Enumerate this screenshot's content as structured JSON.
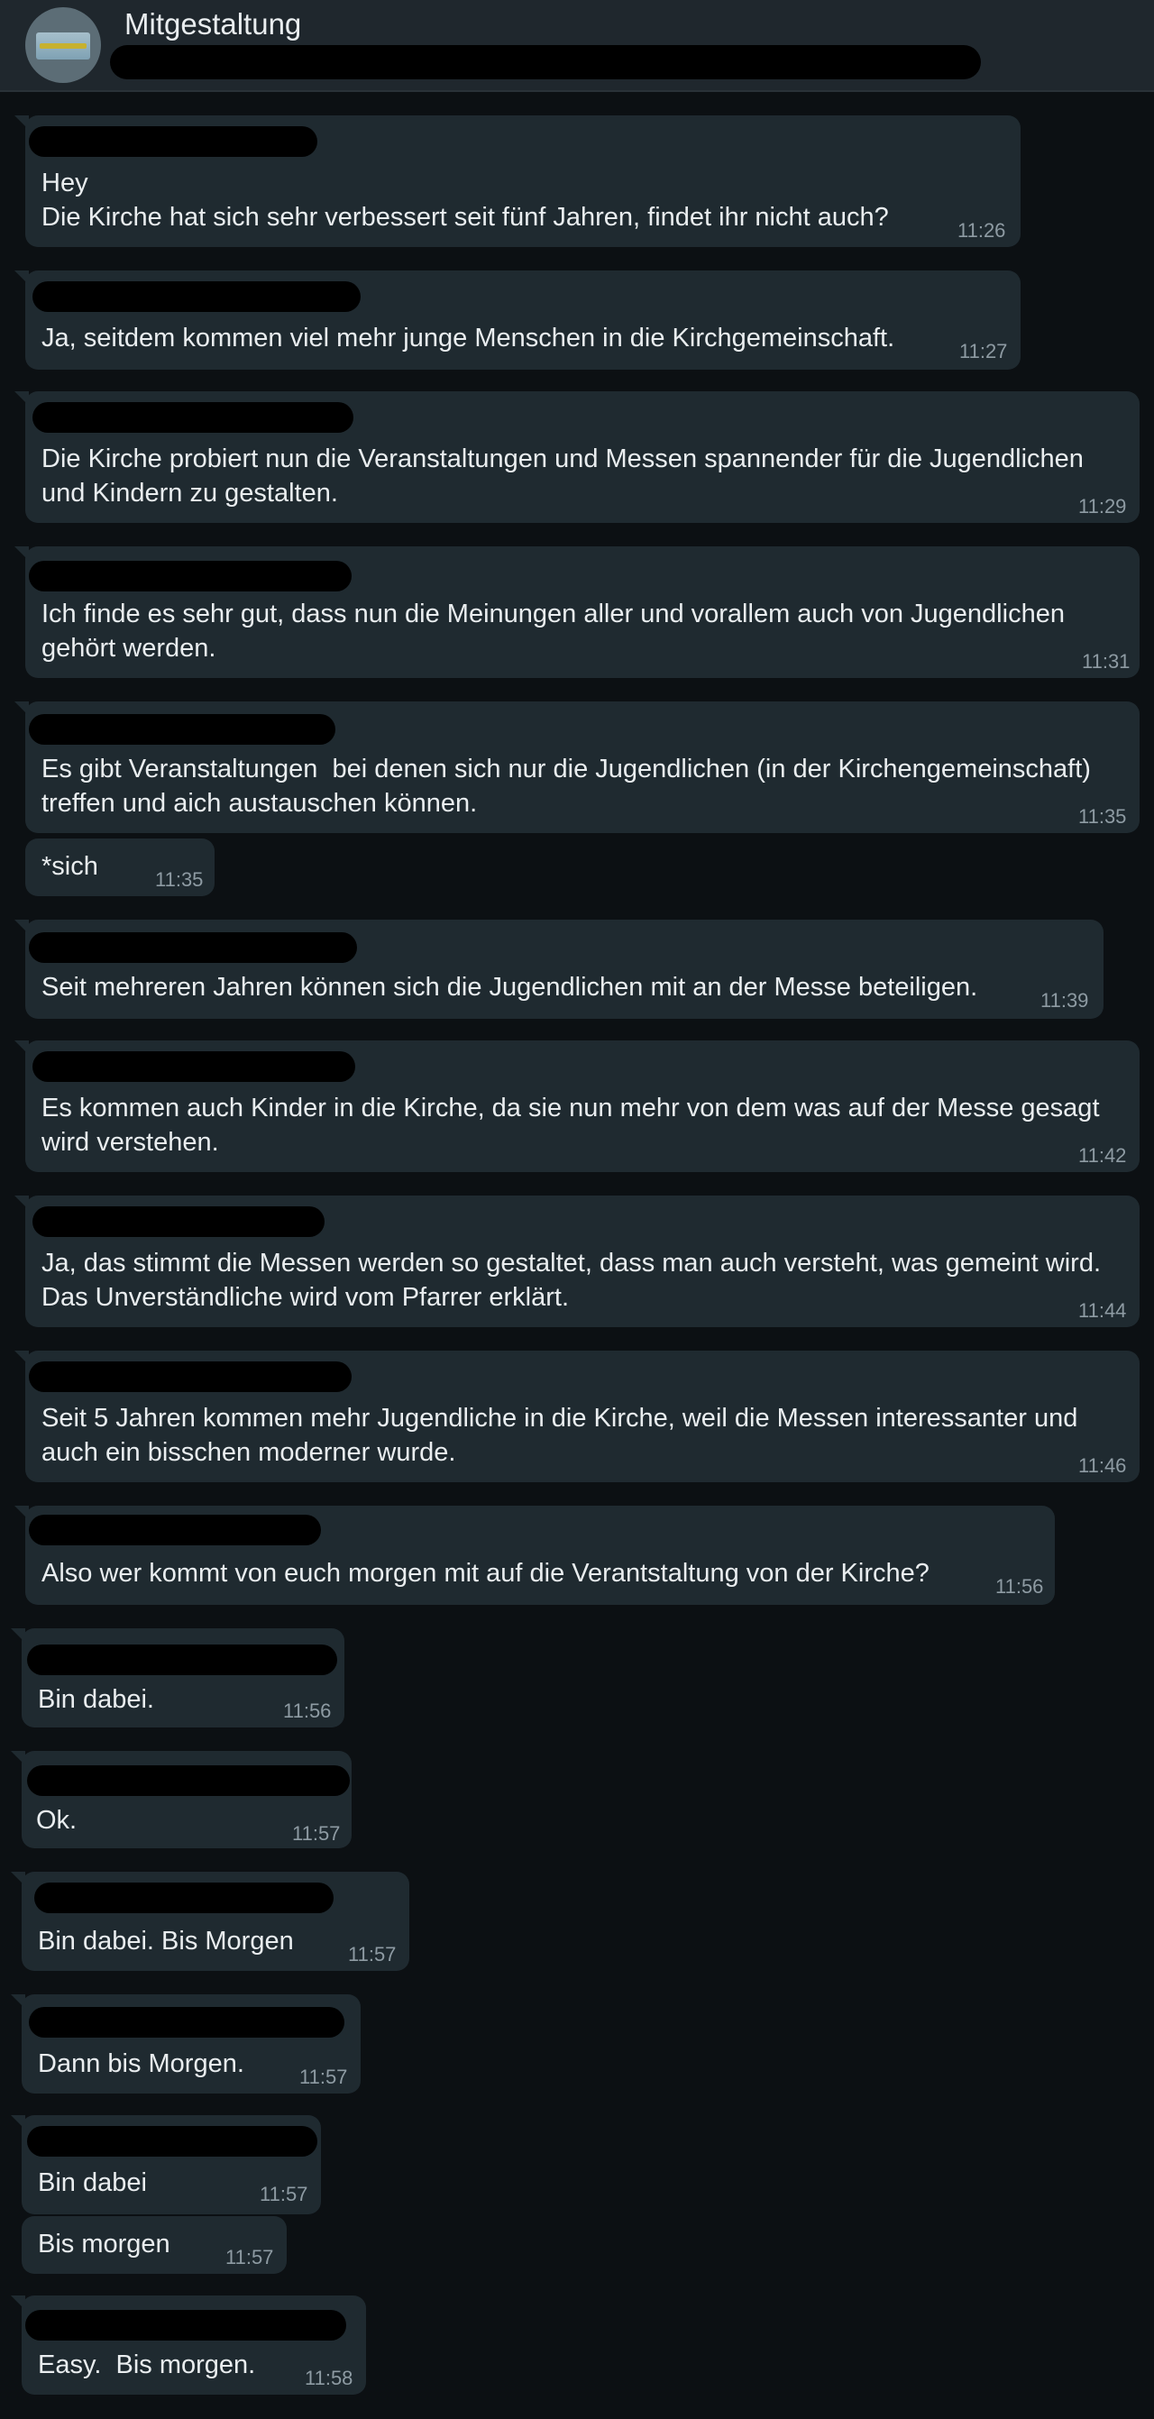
{
  "chat": {
    "title": "Mitgestaltung"
  },
  "messages": [
    {
      "text": "Hey\nDie Kirche hat sich sehr verbessert seit fünf Jahren, findet ihr nicht auch?",
      "time": "11:26"
    },
    {
      "text": "Ja, seitdem kommen viel mehr junge Menschen in die Kirchgemeinschaft.",
      "time": "11:27"
    },
    {
      "text": "Die Kirche probiert nun die Veranstaltungen und Messen spannender für die Jugendlichen\nund Kindern zu gestalten.",
      "time": "11:29"
    },
    {
      "text": "Ich finde es sehr gut, dass nun die Meinungen aller und vorallem auch von Jugendlichen\ngehört werden.",
      "time": "11:31"
    },
    {
      "text": "Es gibt Veranstaltungen  bei denen sich nur die Jugendlichen (in der Kirchengemeinschaft)\ntreffen und aich austauschen können.",
      "time": "11:35"
    },
    {
      "text": "*sich",
      "time": "11:35"
    },
    {
      "text": "Seit mehreren Jahren können sich die Jugendlichen mit an der Messe beteiligen.",
      "time": "11:39"
    },
    {
      "text": "Es kommen auch Kinder in die Kirche, da sie nun mehr von dem was auf der Messe gesagt\nwird verstehen.",
      "time": "11:42"
    },
    {
      "text": "Ja, das stimmt die Messen werden so gestaltet, dass man auch versteht, was gemeint wird.\nDas Unverständliche wird vom Pfarrer erklärt.",
      "time": "11:44"
    },
    {
      "text": "Seit 5 Jahren kommen mehr Jugendliche in die Kirche, weil die Messen interessanter und\nauch ein bisschen moderner wurde.",
      "time": "11:46"
    },
    {
      "text": "Also wer kommt von euch morgen mit auf die Verantstaltung von der Kirche?",
      "time": "11:56"
    },
    {
      "text": "Bin dabei.",
      "time": "11:56"
    },
    {
      "text": "Ok.",
      "time": "11:57"
    },
    {
      "text": "Bin dabei. Bis Morgen",
      "time": "11:57"
    },
    {
      "text": "Dann bis Morgen.",
      "time": "11:57"
    },
    {
      "text": "Bin dabei",
      "time": "11:57"
    },
    {
      "text": "Bis morgen",
      "time": "11:57"
    },
    {
      "text": "Easy.  Bis morgen.",
      "time": "11:58"
    }
  ]
}
